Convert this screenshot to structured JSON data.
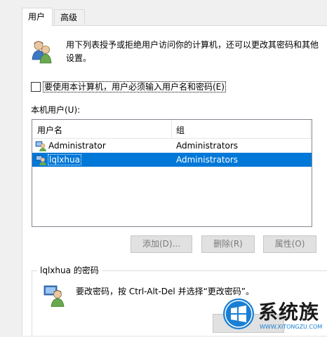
{
  "tabs": [
    {
      "label": "用户"
    },
    {
      "label": "高级"
    }
  ],
  "description": "用下列表授予或拒绝用户访问你的计算机，还可以更改其密码和其他设置。",
  "require_login_checkbox": {
    "label": "要使用本计算机，用户必须输入用户名和密码(E)",
    "checked": false
  },
  "local_users_label": "本机用户(U):",
  "table": {
    "columns": [
      "用户名",
      "组"
    ],
    "rows": [
      {
        "user": "Administrator",
        "group": "Administrators",
        "selected": false
      },
      {
        "user": "lqlxhua",
        "group": "Administrators",
        "selected": true
      }
    ]
  },
  "buttons": {
    "add": "添加(D)...",
    "remove": "删除(R)",
    "properties": "属性(O)"
  },
  "password_group": {
    "title": "lqlxhua 的密码",
    "text": "要改密码，按 Ctrl-Alt-Del 并选择“更改密码”。"
  },
  "watermark": {
    "brand": "系统族",
    "url": "WWW.XITONGZU.COM"
  },
  "colors": {
    "selection": "#0078d7",
    "watermark_blue": "#1a7fd4"
  }
}
